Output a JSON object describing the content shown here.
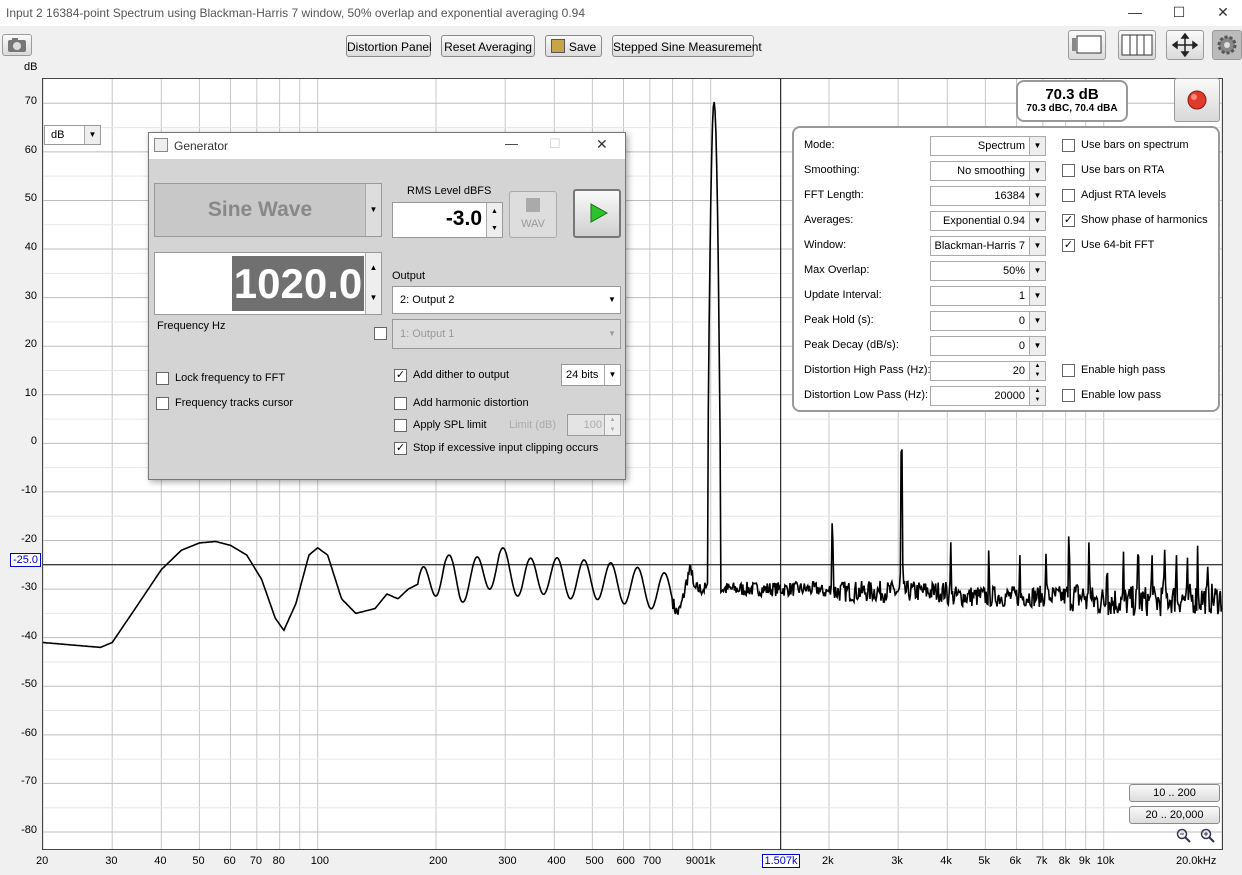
{
  "window": {
    "title": "Input 2 16384-point Spectrum using Blackman-Harris 7 window, 50% overlap and exponential averaging 0.94"
  },
  "toolbar": {
    "distortion_panel": "Distortion Panel",
    "reset_averaging": "Reset Averaging",
    "save": "Save",
    "stepped_sine": "Stepped Sine Measurement"
  },
  "plot": {
    "y_unit": "dB",
    "unit_select": "dB",
    "cursor_y": "-25.0",
    "cursor_x": "1.507k",
    "y_ticks": [
      "70",
      "60",
      "50",
      "40",
      "30",
      "20",
      "10",
      "0",
      "-10",
      "-20",
      "-30",
      "-40",
      "-50",
      "-60",
      "-70",
      "-80"
    ],
    "x_ticks": [
      "20",
      "30",
      "40",
      "50",
      "60",
      "70",
      "80",
      "100",
      "200",
      "300",
      "400",
      "500",
      "600",
      "700",
      "900",
      "1k",
      "2k",
      "3k",
      "4k",
      "5k",
      "6k",
      "7k",
      "8k",
      "9k",
      "10k",
      "20.0kHz"
    ],
    "range_buttons": [
      "10 .. 200",
      "20 .. 20,000"
    ]
  },
  "readout": {
    "main": "70.3 dB",
    "sub": "70.3 dBC, 70.4 dBA"
  },
  "generator": {
    "title": "Generator",
    "waveform": "Sine Wave",
    "rms_label": "RMS Level dBFS",
    "rms_value": "-3.0",
    "wav_label": "WAV",
    "frequency": "1020.0",
    "freq_label": "Frequency Hz",
    "output_label": "Output",
    "output_value": "2: Output 2",
    "output2_value": "1: Output 1",
    "lock_freq": "Lock frequency to FFT",
    "freq_tracks": "Frequency tracks cursor",
    "add_dither": "Add dither to output",
    "bits": "24 bits",
    "add_harmonic": "Add harmonic distortion",
    "apply_spl": "Apply SPL limit",
    "limit_label": "Limit (dB)",
    "limit_value": "100",
    "stop_clipping": "Stop if excessive input clipping occurs"
  },
  "settings": {
    "rows": [
      {
        "label": "Mode:",
        "value": "Spectrum"
      },
      {
        "label": "Smoothing:",
        "value": "No  smoothing"
      },
      {
        "label": "FFT Length:",
        "value": "16384"
      },
      {
        "label": "Averages:",
        "value": "Exponential 0.94"
      },
      {
        "label": "Window:",
        "value": "Blackman-Harris 7"
      },
      {
        "label": "Max Overlap:",
        "value": "50%"
      },
      {
        "label": "Update Interval:",
        "value": "1"
      },
      {
        "label": "Peak Hold (s):",
        "value": "0"
      },
      {
        "label": "Peak Decay (dB/s):",
        "value": "0"
      },
      {
        "label": "Distortion High Pass (Hz):",
        "value": "20"
      },
      {
        "label": "Distortion Low Pass (Hz):",
        "value": "20000"
      }
    ],
    "checks": [
      "Use bars on spectrum",
      "Use bars on RTA",
      "Adjust RTA levels",
      "Show phase of harmonics",
      "Use 64-bit FFT"
    ],
    "enable_high_pass": "Enable high pass",
    "enable_low_pass": "Enable low pass"
  },
  "colors": {
    "cursor_label": "#0000cc",
    "graph_line": "#000000",
    "grid": "#c8c8c8"
  }
}
